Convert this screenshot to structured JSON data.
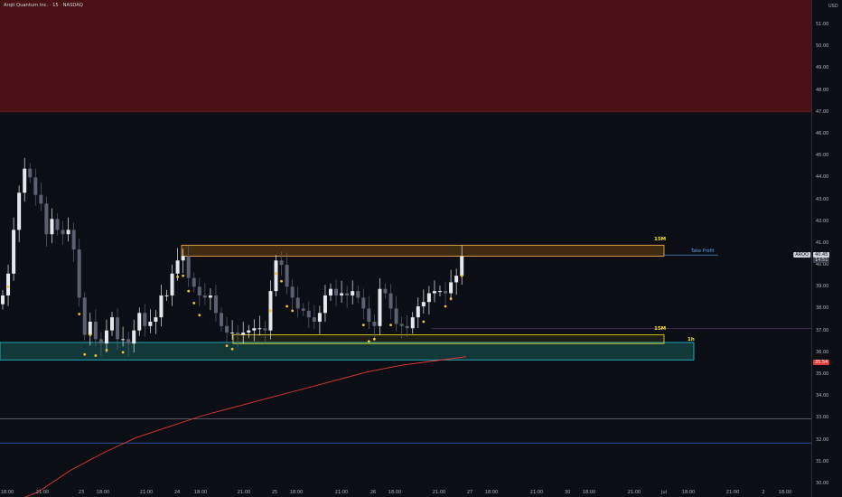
{
  "header": {
    "title": "Arqit Quantum Inc. · 15 · NASDAQ"
  },
  "price_axis": {
    "currency": "USD",
    "ticks": [
      "51.00",
      "50.00",
      "49.00",
      "48.00",
      "47.00",
      "46.00",
      "45.00",
      "44.00",
      "43.00",
      "42.00",
      "41.00",
      "40.00",
      "39.00",
      "38.00",
      "37.00",
      "36.00",
      "35.00",
      "34.00",
      "33.00",
      "32.00",
      "31.00",
      "30.00"
    ],
    "ticker_tag": "ARQQ",
    "last_price": "40.45",
    "countdown": "14:51",
    "ma_value": "35.54"
  },
  "zones": {
    "supply_top_label": "15M",
    "take_profit_label": "Take Profit",
    "demand_mid_label": "15M",
    "demand_htf_label": "1h"
  },
  "time_axis": [
    "18:00",
    "21:00",
    "23",
    "18:00",
    "21:00",
    "24",
    "18:00",
    "21:00",
    "25",
    "18:00",
    "21:00",
    "26",
    "18:00",
    "21:00",
    "27",
    "18:00",
    "21:00",
    "30",
    "18:00",
    "21:00",
    "Jul",
    "18:00",
    "21:00",
    "2",
    "18:00"
  ],
  "colors": {
    "background": "#0c0e15",
    "supply_fill": "#4a1114",
    "zone_orange": "#ffb74d",
    "zone_yellow": "#f7e51a",
    "zone_teal": "#26c6da",
    "ma_line": "#e53935",
    "candle": "#d1d4dc",
    "marker": "#f7c52b"
  },
  "chart_data": {
    "type": "candlestick",
    "title": "",
    "y_range": [
      30,
      51.5
    ],
    "series": [
      {
        "name": "price",
        "values": [
          38.6,
          39.6,
          41.6,
          43.3,
          44.4,
          44.0,
          43.2,
          42.8,
          41.4,
          42.1,
          41.6,
          41.4,
          41.6,
          40.7,
          38.5,
          36.8,
          37.4,
          36.6,
          36.4,
          37.0,
          37.6,
          36.6,
          36.6,
          36.4,
          37.0,
          37.8,
          37.2,
          37.4,
          37.6,
          38.6,
          38.6,
          39.6,
          40.2,
          40.4,
          39.4,
          39.0,
          38.6,
          38.5,
          38.6,
          37.8,
          37.2,
          36.9,
          36.9,
          36.8,
          36.9,
          37.0,
          37.1,
          37.1,
          37.0,
          38.8,
          40.2,
          40.0,
          39.0,
          38.5,
          38.0,
          37.9,
          37.6,
          37.4,
          37.8,
          38.6,
          38.9,
          38.6,
          38.7,
          38.6,
          38.8,
          38.5,
          38.0,
          37.4,
          37.2,
          38.9,
          38.7,
          38.0,
          37.3,
          37.2,
          37.1,
          37.6,
          38.1,
          38.3,
          38.7,
          38.8,
          38.8,
          38.7,
          39.2,
          39.5,
          40.4
        ]
      }
    ],
    "moving_average": [
      29.0,
      29.6,
      30.6,
      31.4,
      32.1,
      32.6,
      33.1,
      33.5,
      33.9,
      34.3,
      34.7,
      35.1,
      35.4,
      35.6,
      35.8
    ],
    "levels": {
      "supply_zone": [
        47.0,
        51.5
      ],
      "top_zone": [
        40.4,
        40.9
      ],
      "mid_zone": [
        36.4,
        36.8
      ],
      "htf_zone": [
        35.65,
        36.45
      ],
      "take_profit": 40.45,
      "purple_line": 37.1,
      "line_33": 32.95,
      "line_32": 31.85
    }
  }
}
